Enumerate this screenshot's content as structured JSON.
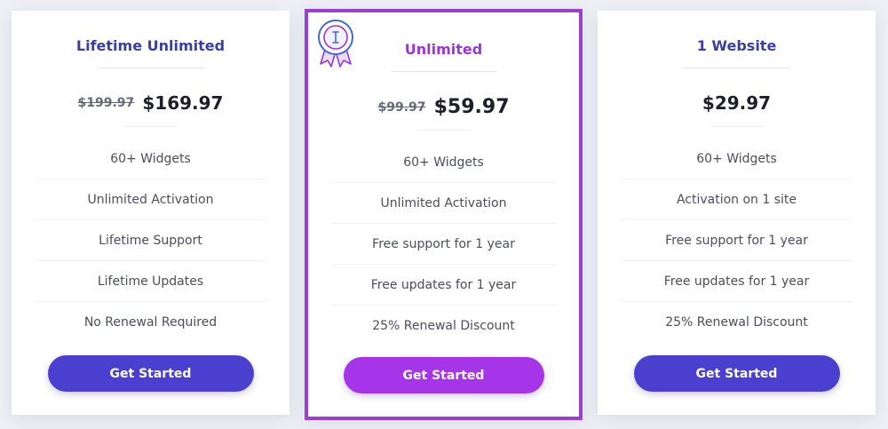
{
  "colors": {
    "title_blue": "#3a3fa8",
    "title_purple": "#9b36d6",
    "button_blue": "#4b3fcf",
    "button_purple": "#a634e8",
    "highlight_border": "#9b3fd0"
  },
  "plans": [
    {
      "title": "Lifetime Unlimited",
      "old_price": "$199.97",
      "price": "$169.97",
      "features": [
        "60+ Widgets",
        "Unlimited Activation",
        "Lifetime Support",
        "Lifetime Updates",
        "No Renewal Required"
      ],
      "button_label": "Get Started"
    },
    {
      "title": "Unlimited",
      "badge_icon": "ribbon-badge-icon",
      "old_price": "$99.97",
      "price": "$59.97",
      "features": [
        "60+ Widgets",
        "Unlimited Activation",
        "Free support for 1 year",
        "Free updates for 1 year",
        "25% Renewal Discount"
      ],
      "button_label": "Get Started"
    },
    {
      "title": "1 Website",
      "price": "$29.97",
      "features": [
        "60+ Widgets",
        "Activation on 1 site",
        "Free support for 1 year",
        "Free updates for 1 year",
        "25% Renewal Discount"
      ],
      "button_label": "Get Started"
    }
  ]
}
